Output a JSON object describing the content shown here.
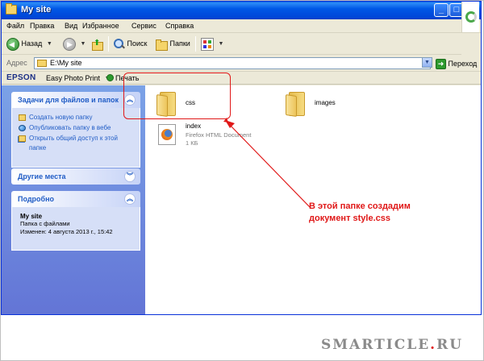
{
  "window": {
    "title": "My site",
    "minimize_glyph": "_",
    "maximize_glyph": "□",
    "close_glyph": "✕"
  },
  "menu": [
    "Файл",
    "Правка",
    "Вид",
    "Избранное",
    "Сервис",
    "Справка"
  ],
  "toolbar": {
    "back_label": "Назад",
    "search_label": "Поиск",
    "folders_label": "Папки"
  },
  "address": {
    "label": "Адрес",
    "value": "E:\\My site",
    "go_label": "Переход"
  },
  "epson": {
    "logo": "EPSON",
    "menu_label": "Easy Photo Print",
    "print_label": "Печать"
  },
  "sidebar": {
    "tasks": {
      "title": "Задачи для файлов и папок",
      "items": [
        "Создать новую папку",
        "Опубликовать папку в вебе",
        "Открыть общий доступ к этой",
        "папке"
      ]
    },
    "other_places": {
      "title": "Другие места"
    },
    "details": {
      "title": "Подробно",
      "name": "My site",
      "type": "Папка с файлами",
      "modified": "Изменен: 4 августа 2013 г., 15:42"
    }
  },
  "files": [
    {
      "name": "css",
      "kind": "folder"
    },
    {
      "name": "images",
      "kind": "folder"
    },
    {
      "name": "index",
      "kind": "file",
      "type": "Firefox HTML Document",
      "size": "1 КБ"
    }
  ],
  "annotation": {
    "line1": "В этой папке создадим",
    "line2": "документ style.css",
    "color": "#e01818"
  },
  "watermark": {
    "text_main": "SMARTICLE",
    "text_dot": ".",
    "text_tail": "RU"
  }
}
